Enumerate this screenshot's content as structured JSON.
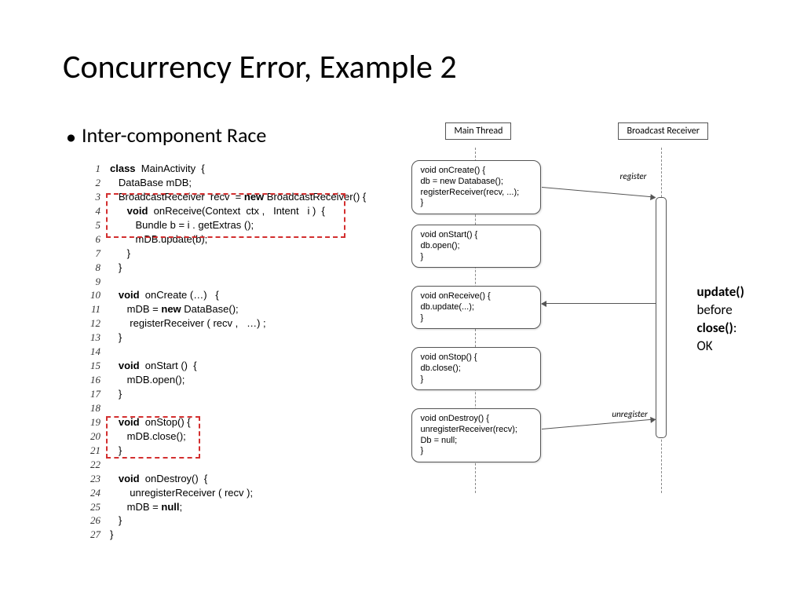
{
  "title": "Concurrency Error, Example 2",
  "bullet": "Inter-component Race",
  "code": {
    "l1a": "class",
    "l1b": "  MainActivity  {",
    "l2": "   DataBase mDB;",
    "l3a": "   BroadcastReceiver  recv  = ",
    "l3b": "new",
    "l3c": " BroadcastReceiver() {",
    "l4a": "      ",
    "l4b": "void",
    "l4c": "  onReceive(Context  ctx ,   Intent   i )  {",
    "l5": "         Bundle b = i . getExtras ();",
    "l6": "         mDB.update(b);",
    "l7": "      }",
    "l8": "   }",
    "l9": "",
    "l10a": "   ",
    "l10b": "void",
    "l10c": "  onCreate (…)   {",
    "l11a": "      mDB = ",
    "l11b": "new",
    "l11c": " DataBase();",
    "l12": "       registerReceiver ( recv ,   …) ;",
    "l13": "   }",
    "l14": "",
    "l15a": "   ",
    "l15b": "void",
    "l15c": "  onStart ()  {",
    "l16": "      mDB.open();",
    "l17": "   }",
    "l18": "",
    "l19a": "   ",
    "l19b": "void",
    "l19c": "  onStop() {",
    "l20": "      mDB.close();",
    "l21": "   }",
    "l22": "",
    "l23a": "   ",
    "l23b": "void",
    "l23c": "  onDestroy()  {",
    "l24": "       unregisterReceiver ( recv );",
    "l25a": "      mDB = ",
    "l25b": "null",
    "l25c": ";",
    "l26": "   }",
    "l27": "}"
  },
  "seq": {
    "head1": "Main Thread",
    "head2": "Broadcast Receiver",
    "box1": "void onCreate() {\n   db = new Database();\n   registerReceiver(recv, ...);\n}",
    "box2": "void onStart() {\n   db.open();\n}",
    "box3": "void onReceive() {\n   db.update(...);\n}",
    "box4": "void onStop() {\n   db.close();\n}",
    "box5": "void onDestroy() {\n   unregisterReceiver(recv);\n   Db = null;\n}",
    "label_reg": "register",
    "label_unreg": "unregister"
  },
  "note": {
    "l1": "update()",
    "l2": "before",
    "l3": "close()",
    "l4": ":",
    "l5": "OK"
  }
}
